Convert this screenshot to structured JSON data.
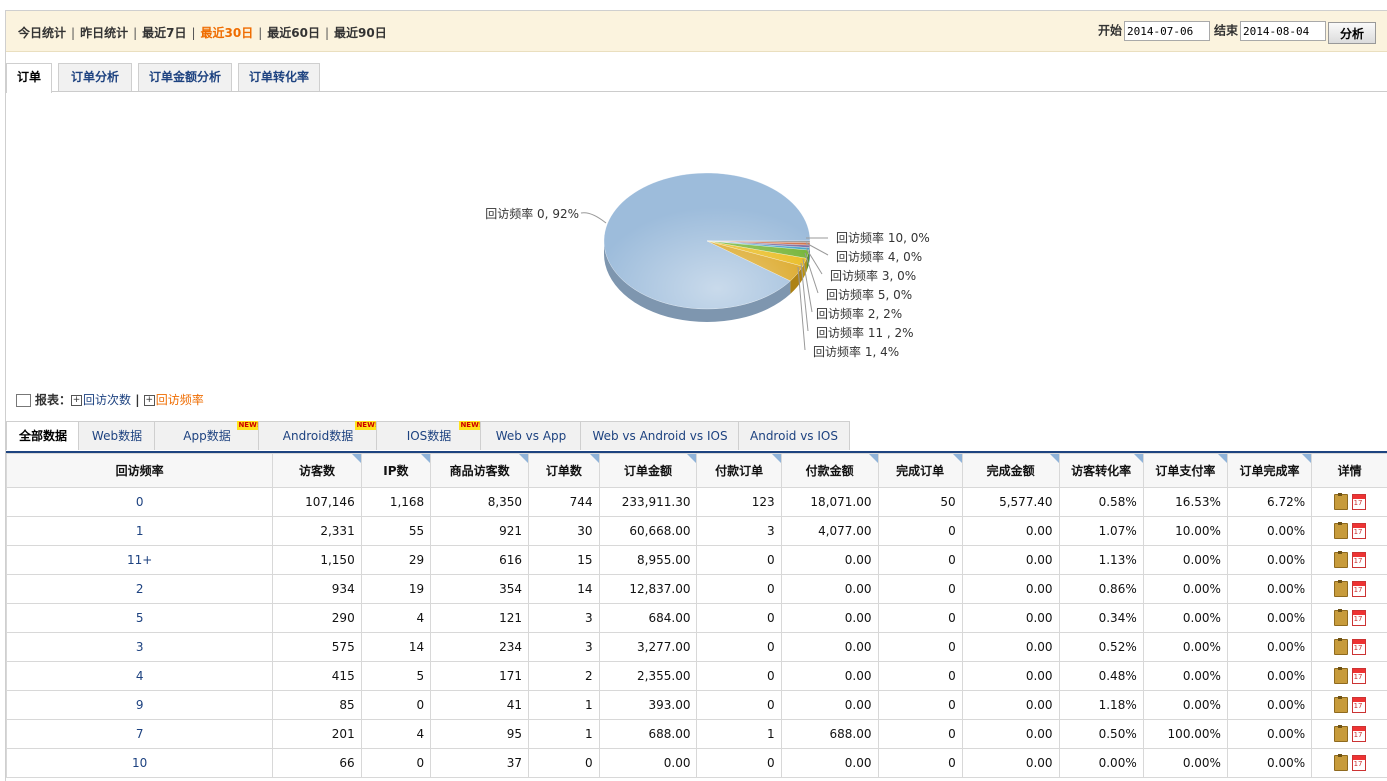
{
  "ranges": [
    "今日统计",
    "昨日统计",
    "最近7日",
    "最近30日",
    "最近60日",
    "最近90日"
  ],
  "active_range": "最近30日",
  "date": {
    "start_label": "开始",
    "start": "2014-07-06",
    "end_label": "结束",
    "end": "2014-08-04",
    "analyze_label": "分析"
  },
  "chart_tabs": [
    "订单",
    "订单分析",
    "订单金额分析",
    "订单转化率"
  ],
  "chart_data": {
    "type": "pie",
    "slices": [
      {
        "label": "回访频率 0, 92%",
        "value": 92,
        "color": "#9dbcdb"
      },
      {
        "label": "回访频率 1, 4%",
        "value": 4,
        "color": "#d9a219"
      },
      {
        "label": "回访频率 11 , 2%",
        "value": 2,
        "color": "#e8b814"
      },
      {
        "label": "回访频率 2, 2%",
        "value": 2,
        "color": "#6fb130"
      },
      {
        "label": "回访频率 5, 0%",
        "value": 0.6,
        "color": "#3fa0c8"
      },
      {
        "label": "回访频率 3, 0%",
        "value": 0.6,
        "color": "#7d6a9f"
      },
      {
        "label": "回访频率 4, 0%",
        "value": 0.6,
        "color": "#d26f45"
      },
      {
        "label": "回访频率 10, 0%",
        "value": 0.4,
        "color": "#888888"
      }
    ]
  },
  "report": {
    "label": "报表：",
    "links": [
      "回访次数",
      "回访频率"
    ],
    "active_link": "回访频率"
  },
  "data_tabs": [
    {
      "label": "全部数据",
      "new": false
    },
    {
      "label": "Web数据",
      "new": false
    },
    {
      "label": "App数据",
      "new": true
    },
    {
      "label": "Android数据",
      "new": true
    },
    {
      "label": "IOS数据",
      "new": true
    },
    {
      "label": "Web vs App",
      "new": false
    },
    {
      "label": "Web vs Android vs IOS",
      "new": false
    },
    {
      "label": "Android vs IOS",
      "new": false
    }
  ],
  "new_badge": "NEW!",
  "table": {
    "headers": [
      "回访频率",
      "访客数",
      "IP数",
      "商品访客数",
      "订单数",
      "订单金额",
      "付款订单",
      "付款金额",
      "完成订单",
      "完成金额",
      "访客转化率",
      "订单支付率",
      "订单完成率",
      "详情"
    ],
    "rows": [
      [
        "0",
        "107,146",
        "1,168",
        "8,350",
        "744",
        "233,911.30",
        "123",
        "18,071.00",
        "50",
        "5,577.40",
        "0.58%",
        "16.53%",
        "6.72%"
      ],
      [
        "1",
        "2,331",
        "55",
        "921",
        "30",
        "60,668.00",
        "3",
        "4,077.00",
        "0",
        "0.00",
        "1.07%",
        "10.00%",
        "0.00%"
      ],
      [
        "11+",
        "1,150",
        "29",
        "616",
        "15",
        "8,955.00",
        "0",
        "0.00",
        "0",
        "0.00",
        "1.13%",
        "0.00%",
        "0.00%"
      ],
      [
        "2",
        "934",
        "19",
        "354",
        "14",
        "12,837.00",
        "0",
        "0.00",
        "0",
        "0.00",
        "0.86%",
        "0.00%",
        "0.00%"
      ],
      [
        "5",
        "290",
        "4",
        "121",
        "3",
        "684.00",
        "0",
        "0.00",
        "0",
        "0.00",
        "0.34%",
        "0.00%",
        "0.00%"
      ],
      [
        "3",
        "575",
        "14",
        "234",
        "3",
        "3,277.00",
        "0",
        "0.00",
        "0",
        "0.00",
        "0.52%",
        "0.00%",
        "0.00%"
      ],
      [
        "4",
        "415",
        "5",
        "171",
        "2",
        "2,355.00",
        "0",
        "0.00",
        "0",
        "0.00",
        "0.48%",
        "0.00%",
        "0.00%"
      ],
      [
        "9",
        "85",
        "0",
        "41",
        "1",
        "393.00",
        "0",
        "0.00",
        "0",
        "0.00",
        "1.18%",
        "0.00%",
        "0.00%"
      ],
      [
        "7",
        "201",
        "4",
        "95",
        "1",
        "688.00",
        "1",
        "688.00",
        "0",
        "0.00",
        "0.50%",
        "100.00%",
        "0.00%"
      ],
      [
        "10",
        "66",
        "0",
        "37",
        "0",
        "0.00",
        "0",
        "0.00",
        "0",
        "0.00",
        "0.00%",
        "0.00%",
        "0.00%"
      ]
    ]
  },
  "icons": {
    "detail": "clipboard-icon",
    "calendar": "calendar-icon"
  }
}
